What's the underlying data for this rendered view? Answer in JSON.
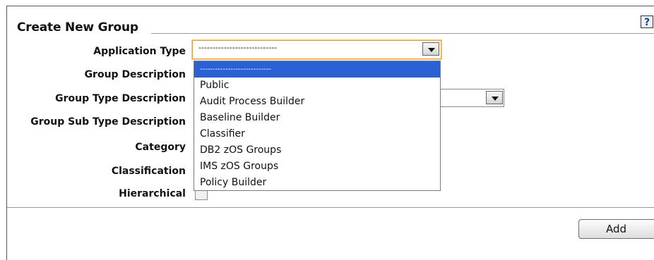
{
  "form": {
    "title": "Create New Group",
    "help_glyph": "?",
    "help_icon": "help-icon",
    "labels": {
      "application_type": "Application Type",
      "group_description": "Group Description",
      "group_type_description": "Group Type Description",
      "group_sub_type_description": "Group Sub Type Description",
      "category": "Category",
      "classification": "Classification",
      "hierarchical": "Hierarchical"
    },
    "application_type": {
      "selected": "----------------------------",
      "options": [
        "----------------------------",
        "Public",
        "Audit Process Builder",
        "Baseline Builder",
        "Classifier",
        "DB2 zOS Groups",
        "IMS zOS Groups",
        "Policy Builder"
      ]
    },
    "hierarchical_checked": false,
    "add_label": "Add"
  },
  "colors": {
    "focus_border": "#e8a33d",
    "selected_option_bg": "#2a62d6"
  }
}
